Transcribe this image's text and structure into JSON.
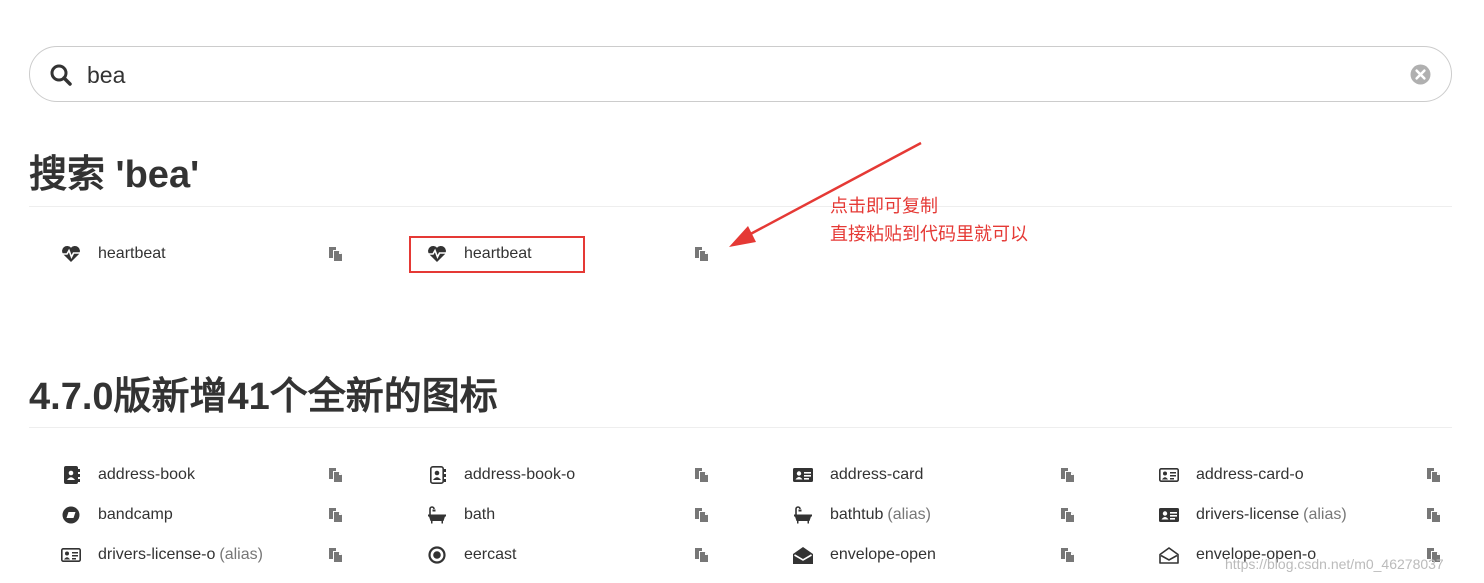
{
  "search": {
    "query": "bea",
    "search_icon": "search-icon",
    "clear_icon": "times-circle-icon"
  },
  "results": {
    "title": "搜索 'bea'",
    "items": [
      {
        "name": "heartbeat",
        "icon": "heartbeat-icon"
      },
      {
        "name": "heartbeat",
        "icon": "heartbeat-icon"
      }
    ]
  },
  "annotation": {
    "line1": "点击即可复制",
    "line2": "直接粘贴到代码里就可以",
    "color": "#e53935"
  },
  "new_icons": {
    "title": "4.7.0版新增41个全新的图标",
    "rows": [
      [
        {
          "name": "address-book",
          "icon": "address-book-icon"
        },
        {
          "name": "address-book-o",
          "icon": "address-book-o-icon"
        },
        {
          "name": "address-card",
          "icon": "address-card-icon"
        },
        {
          "name": "address-card-o",
          "icon": "address-card-o-icon"
        }
      ],
      [
        {
          "name": "bandcamp",
          "icon": "bandcamp-icon"
        },
        {
          "name": "bath",
          "icon": "bath-icon"
        },
        {
          "name": "bathtub",
          "alias": "(alias)",
          "icon": "bathtub-icon"
        },
        {
          "name": "drivers-license",
          "alias": "(alias)",
          "icon": "drivers-license-icon"
        }
      ],
      [
        {
          "name": "drivers-license-o",
          "alias": "(alias)",
          "icon": "drivers-license-o-icon"
        },
        {
          "name": "eercast",
          "icon": "eercast-icon"
        },
        {
          "name": "envelope-open",
          "icon": "envelope-open-icon"
        },
        {
          "name": "envelope-open-o",
          "icon": "envelope-open-o-icon"
        }
      ]
    ]
  },
  "copy_icon": "copy-icon",
  "watermark": "https://blog.csdn.net/m0_46278037"
}
